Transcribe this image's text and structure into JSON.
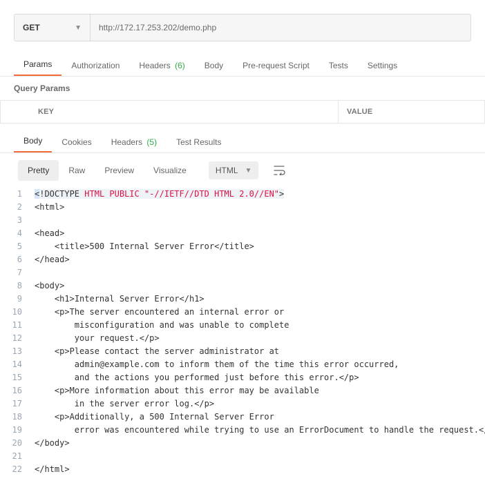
{
  "request": {
    "method": "GET",
    "url": "http://172.17.253.202/demo.php"
  },
  "req_tabs": {
    "params": "Params",
    "authorization": "Authorization",
    "headers_label": "Headers",
    "headers_count": "(6)",
    "body": "Body",
    "prerequest": "Pre-request Script",
    "tests": "Tests",
    "settings": "Settings"
  },
  "query_section": {
    "title": "Query Params",
    "key_header": "KEY",
    "value_header": "VALUE"
  },
  "resp_tabs": {
    "body": "Body",
    "cookies": "Cookies",
    "headers_label": "Headers",
    "headers_count": "(5)",
    "test_results": "Test Results"
  },
  "view_tabs": {
    "pretty": "Pretty",
    "raw": "Raw",
    "preview": "Preview",
    "visualize": "Visualize",
    "lang": "HTML"
  },
  "code": [
    {
      "n": 1,
      "pad": 0,
      "segs": [
        [
          "tok-tag",
          "<"
        ],
        [
          "tok-tag",
          "!DOCTYPE "
        ],
        [
          "tok-doctype-kw",
          "HTML PUBLIC \"-//IETF//DTD HTML 2.0//EN\""
        ],
        [
          "tok-tag",
          ">"
        ]
      ]
    },
    {
      "n": 2,
      "pad": 0,
      "segs": [
        [
          "tok-tag",
          "<html>"
        ]
      ]
    },
    {
      "n": 3,
      "pad": 0,
      "segs": [
        [
          "",
          ""
        ]
      ]
    },
    {
      "n": 4,
      "pad": 0,
      "segs": [
        [
          "tok-tag",
          "<head>"
        ]
      ]
    },
    {
      "n": 5,
      "pad": 1,
      "segs": [
        [
          "tok-tag",
          "<title>"
        ],
        [
          "tok-text",
          "500 Internal Server Error"
        ],
        [
          "tok-tag",
          "</title>"
        ]
      ]
    },
    {
      "n": 6,
      "pad": 0,
      "segs": [
        [
          "tok-tag",
          "</head>"
        ]
      ]
    },
    {
      "n": 7,
      "pad": 0,
      "segs": [
        [
          "",
          ""
        ]
      ]
    },
    {
      "n": 8,
      "pad": 0,
      "segs": [
        [
          "tok-tag",
          "<body>"
        ]
      ]
    },
    {
      "n": 9,
      "pad": 1,
      "segs": [
        [
          "tok-tag",
          "<h1>"
        ],
        [
          "tok-text",
          "Internal Server Error"
        ],
        [
          "tok-tag",
          "</h1>"
        ]
      ]
    },
    {
      "n": 10,
      "pad": 1,
      "segs": [
        [
          "tok-tag",
          "<p>"
        ],
        [
          "tok-text",
          "The server encountered an internal error or"
        ]
      ]
    },
    {
      "n": 11,
      "pad": 2,
      "segs": [
        [
          "tok-text",
          "misconfiguration and was unable to complete"
        ]
      ]
    },
    {
      "n": 12,
      "pad": 2,
      "segs": [
        [
          "tok-text",
          "your request."
        ],
        [
          "tok-tag",
          "</p>"
        ]
      ]
    },
    {
      "n": 13,
      "pad": 1,
      "segs": [
        [
          "tok-tag",
          "<p>"
        ],
        [
          "tok-text",
          "Please contact the server administrator at"
        ]
      ]
    },
    {
      "n": 14,
      "pad": 2,
      "segs": [
        [
          "tok-text",
          "admin@example.com to inform them of the time this error occurred,"
        ]
      ]
    },
    {
      "n": 15,
      "pad": 2,
      "segs": [
        [
          "tok-text",
          "and the actions you performed just before this error."
        ],
        [
          "tok-tag",
          "</p>"
        ]
      ]
    },
    {
      "n": 16,
      "pad": 1,
      "segs": [
        [
          "tok-tag",
          "<p>"
        ],
        [
          "tok-text",
          "More information about this error may be available"
        ]
      ]
    },
    {
      "n": 17,
      "pad": 2,
      "segs": [
        [
          "tok-text",
          "in the server error log."
        ],
        [
          "tok-tag",
          "</p>"
        ]
      ]
    },
    {
      "n": 18,
      "pad": 1,
      "segs": [
        [
          "tok-tag",
          "<p>"
        ],
        [
          "tok-text",
          "Additionally, a 500 Internal Server Error"
        ]
      ]
    },
    {
      "n": 19,
      "pad": 2,
      "segs": [
        [
          "tok-text",
          "error was encountered while trying to use an ErrorDocument to handle the request."
        ],
        [
          "tok-tag",
          "</p>"
        ]
      ]
    },
    {
      "n": 20,
      "pad": 0,
      "segs": [
        [
          "tok-tag",
          "</body>"
        ]
      ]
    },
    {
      "n": 21,
      "pad": 0,
      "segs": [
        [
          "",
          ""
        ]
      ]
    },
    {
      "n": 22,
      "pad": 0,
      "segs": [
        [
          "tok-tag",
          "</html>"
        ]
      ]
    }
  ]
}
